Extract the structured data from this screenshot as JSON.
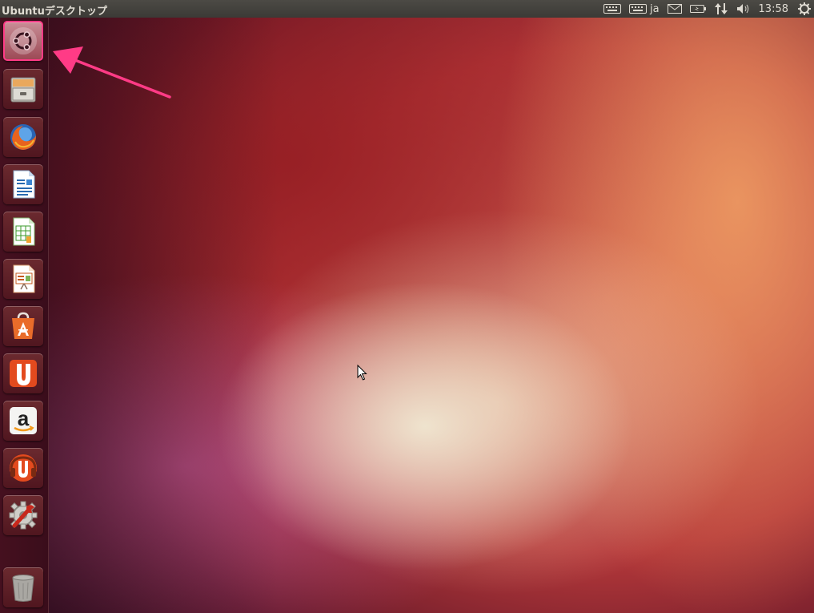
{
  "panel": {
    "title": "Ubuntuデスクトップ",
    "lang": "ja",
    "clock": "13:58"
  },
  "indicators": [
    "keyboard-icon",
    "keyboard-layout-icon",
    "mail-icon",
    "battery-icon",
    "network-icon",
    "volume-icon",
    "power-gear-icon"
  ],
  "launcher": {
    "items": [
      {
        "name": "Dash Home",
        "icon": "ubuntu-dash-icon"
      },
      {
        "name": "Files",
        "icon": "file-cabinet-icon"
      },
      {
        "name": "Firefox",
        "icon": "firefox-icon"
      },
      {
        "name": "Writer",
        "icon": "libreoffice-writer-icon"
      },
      {
        "name": "Calc",
        "icon": "libreoffice-calc-icon"
      },
      {
        "name": "Impress",
        "icon": "libreoffice-impress-icon"
      },
      {
        "name": "Software Center",
        "icon": "software-center-icon"
      },
      {
        "name": "Ubuntu One",
        "icon": "ubuntu-one-icon"
      },
      {
        "name": "Amazon",
        "icon": "amazon-icon",
        "label": "a"
      },
      {
        "name": "Ubuntu One Music",
        "icon": "ubuntu-one-music-icon"
      },
      {
        "name": "System Settings",
        "icon": "system-settings-icon"
      },
      {
        "name": "Trash",
        "icon": "trash-icon"
      }
    ]
  },
  "colors": {
    "panel": "#3c3b37",
    "launcher": "#3f0f1e",
    "highlight": "#ff3b86",
    "accent_orange": "#e95420"
  }
}
